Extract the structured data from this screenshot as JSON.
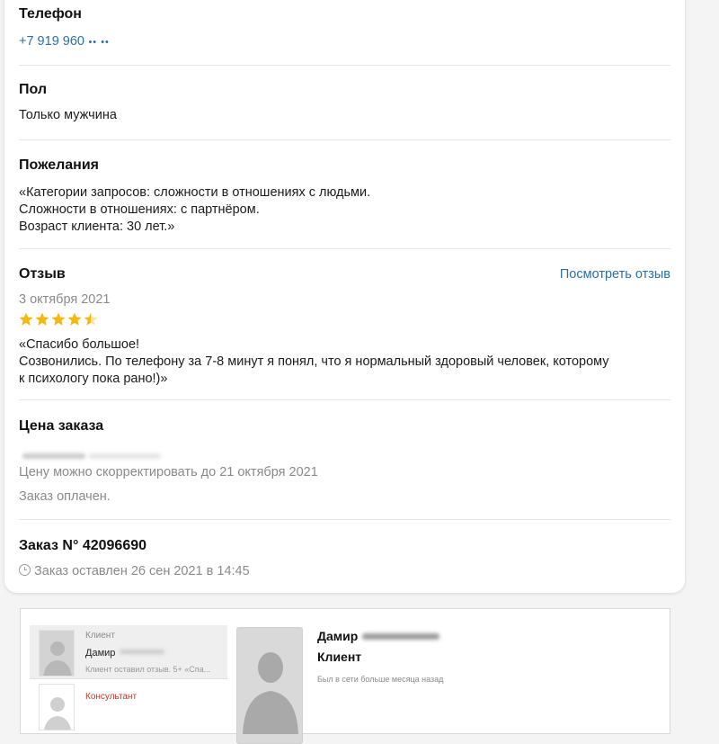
{
  "phone": {
    "title": "Телефон",
    "value": "+7 919 960",
    "masked": "•• ••"
  },
  "gender": {
    "title": "Пол",
    "value": "Только мужчина"
  },
  "wishes": {
    "title": "Пожелания",
    "lines": [
      "«Категории запросов: сложности в отношениях с людьми.",
      "Сложности в отношениях: с партнёром.",
      "Возраст клиента: 30 лет.»"
    ]
  },
  "review": {
    "title": "Отзыв",
    "link": "Посмотреть отзыв",
    "date": "3 октября 2021",
    "rating": 4.5,
    "rating_max": 5,
    "star_color": "#f5b80c",
    "lines": [
      "«Спасибо большое!",
      "Созвонились. По телефону за 7-8 минут я понял, что я нормальный здоровый человек, которому",
      "к психологу пока рано!)»"
    ]
  },
  "price": {
    "title": "Цена заказа",
    "note": "Цену можно скорректировать до 21 октября 2021",
    "status": "Заказ оплачен."
  },
  "order": {
    "title": "Заказ N° 42096690",
    "created": "Заказ оставлен 26 сен 2021 в 14:45",
    "icon": "clock-icon"
  },
  "chat": {
    "items": [
      {
        "role": "Клиент",
        "name": "Дамир",
        "preview": "Клиент оставил отзыв. 5+ «Спа..."
      },
      {
        "role": "Консультант"
      }
    ],
    "profile": {
      "name": "Дамир",
      "role": "Клиент",
      "status": "Был в сети больше месяца назад"
    }
  },
  "colors": {
    "link": "#2b6fa8",
    "muted": "#8a8a8a",
    "accent_red": "#c0392b"
  }
}
